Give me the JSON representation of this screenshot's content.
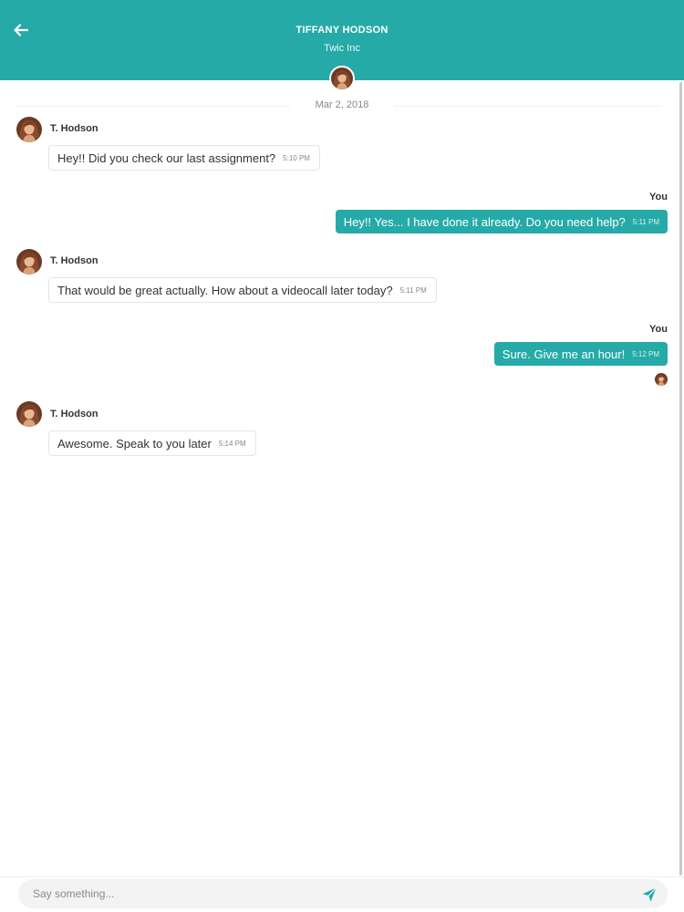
{
  "header": {
    "title": "TIFFANY HODSON",
    "subtitle": "Twic Inc",
    "back_icon": "arrow-left-icon",
    "avatar_icon": "contact-avatar"
  },
  "conversation": {
    "date": "Mar 2, 2018",
    "messages": [
      {
        "direction": "in",
        "sender": "T. Hodson",
        "text": "Hey!! Did you check our last assignment?",
        "time": "5:10 PM"
      },
      {
        "direction": "out",
        "sender": "You",
        "text": "Hey!! Yes... I have done it already. Do you need help?",
        "time": "5:11 PM"
      },
      {
        "direction": "in",
        "sender": "T. Hodson",
        "text": "That would be great actually. How about a videocall later today?",
        "time": "5:11 PM"
      },
      {
        "direction": "out",
        "sender": "You",
        "text": "Sure. Give me an hour!",
        "time": "5:12 PM"
      },
      {
        "direction": "in",
        "sender": "T. Hodson",
        "text": "Awesome. Speak to you later",
        "time": "5:14 PM"
      }
    ]
  },
  "composer": {
    "placeholder": "Say something...",
    "value": "",
    "send_icon": "send-icon"
  },
  "colors": {
    "accent": "#26aaa8",
    "outgoing_bubble": "#26aaa8",
    "incoming_bubble": "#ffffff",
    "composer_bg": "#f3f3f3"
  }
}
